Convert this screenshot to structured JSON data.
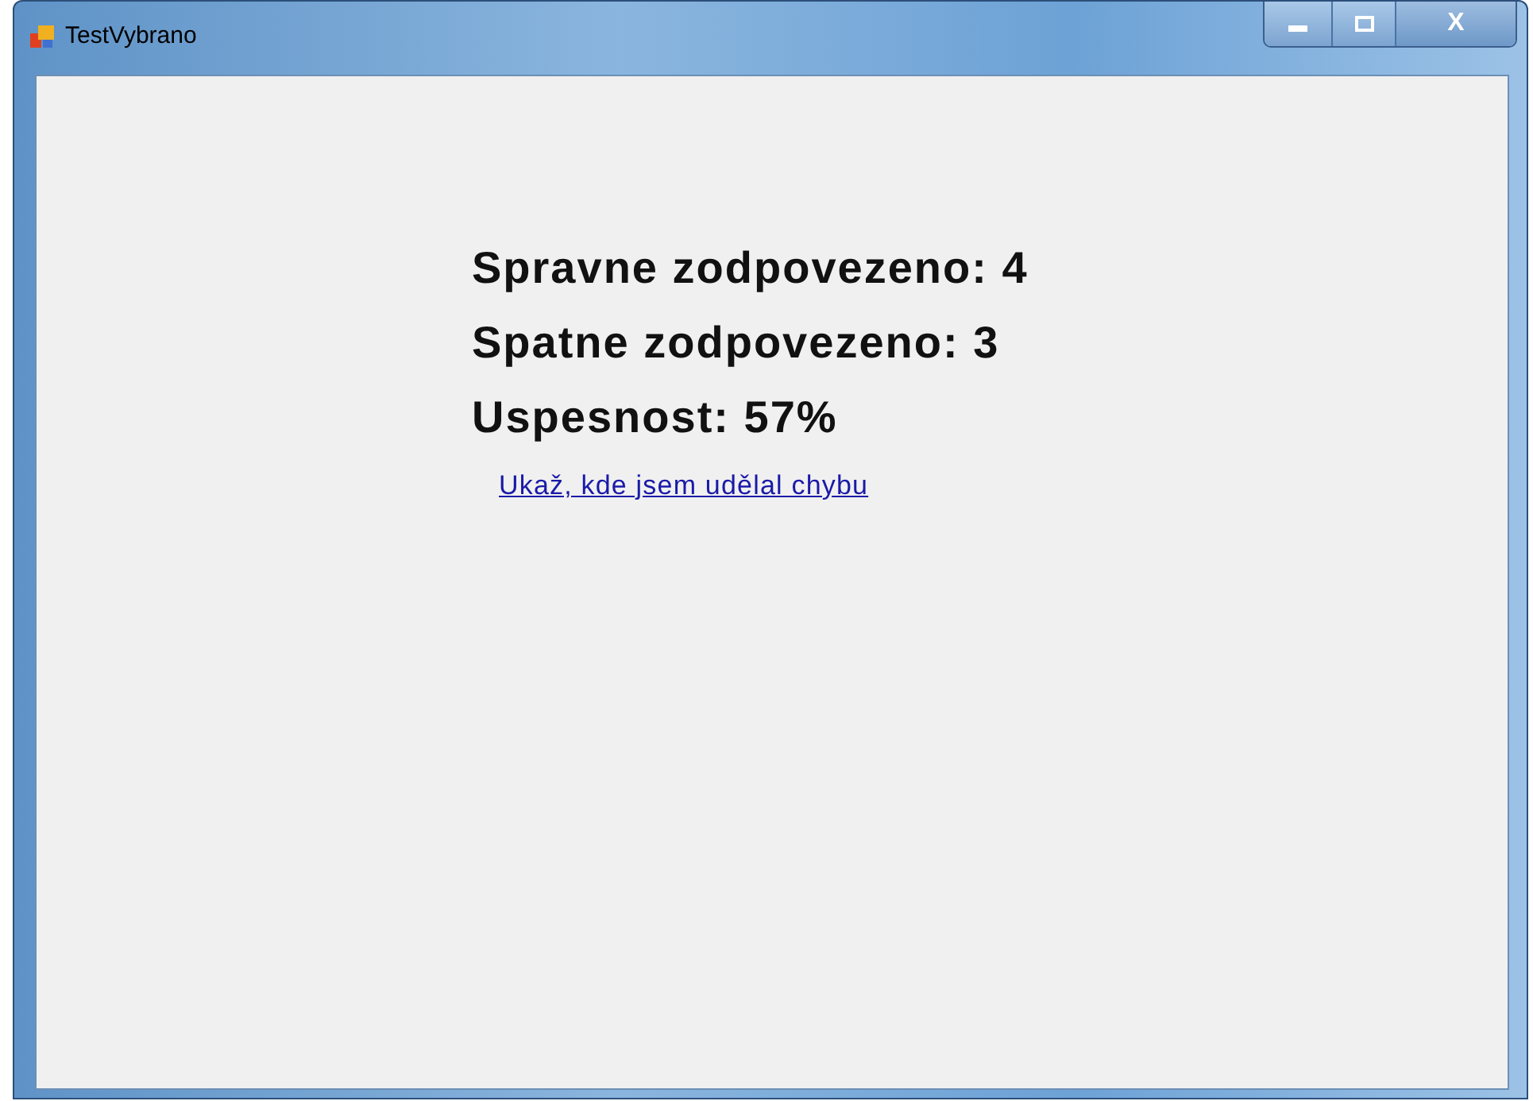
{
  "window": {
    "title": "TestVybrano",
    "close_glyph": "X"
  },
  "results": [
    "Spravne zodpovezeno: 4",
    "Spatne zodpovezeno: 3",
    "Uspesnost: 57%"
  ],
  "link": "Ukaž, kde jsem udělal chybu"
}
